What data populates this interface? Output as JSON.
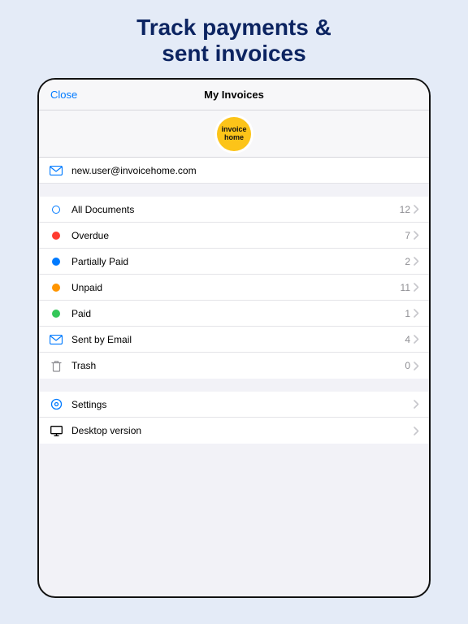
{
  "headline_l1": "Track payments &",
  "headline_l2": "sent invoices",
  "nav": {
    "close": "Close",
    "title": "My Invoices"
  },
  "logo": {
    "l1": "invoice",
    "l2": "home"
  },
  "user": {
    "email": "new.user@invoicehome.com"
  },
  "filters": [
    {
      "label": "All Documents",
      "count": "12",
      "icon": "ring",
      "color": "#007aff"
    },
    {
      "label": "Overdue",
      "count": "7",
      "icon": "dot",
      "color": "#ff3b30"
    },
    {
      "label": "Partially Paid",
      "count": "2",
      "icon": "dot",
      "color": "#007aff"
    },
    {
      "label": "Unpaid",
      "count": "11",
      "icon": "dot",
      "color": "#ff9500"
    },
    {
      "label": "Paid",
      "count": "1",
      "icon": "dot",
      "color": "#34c759"
    },
    {
      "label": "Sent by Email",
      "count": "4",
      "icon": "mail",
      "color": "#007aff"
    },
    {
      "label": "Trash",
      "count": "0",
      "icon": "trash",
      "color": "#8e8e93"
    }
  ],
  "menu": [
    {
      "label": "Settings",
      "icon": "gear",
      "color": "#007aff"
    },
    {
      "label": "Desktop version",
      "icon": "desktop",
      "color": "#000000"
    }
  ]
}
